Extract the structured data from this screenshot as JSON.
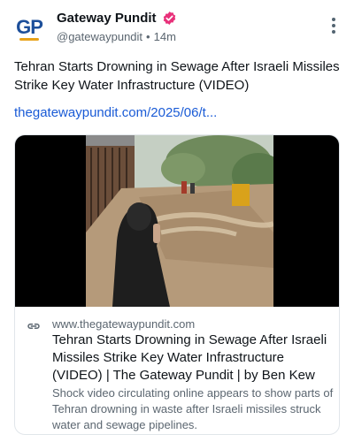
{
  "account": {
    "avatar_text": "GP",
    "display_name": "Gateway Pundit",
    "handle": "@gatewaypundit",
    "separator": "•",
    "time_ago": "14m",
    "verified": true
  },
  "post": {
    "text": "Tehran Starts Drowning in Sewage After Israeli Missiles Strike Key Water Infrastructure (VIDEO)",
    "link": "thegatewaypundit.com/2025/06/t..."
  },
  "card": {
    "domain": "www.thegatewaypundit.com",
    "title": "Tehran Starts Drowning in Sewage After Israeli Missiles Strike Key Water Infrastructure (VIDEO) | The Gateway Pundit | by Ben Kew",
    "description": "Shock video circulating online appears to show parts of Tehran drowning in waste after Israeli missiles struck water and sewage pipelines."
  },
  "colors": {
    "verified_badge": "#e8317a",
    "link": "#1a5bd6",
    "avatar_brand": "#1d4f9a",
    "avatar_accent": "#e8a21a"
  },
  "icons": {
    "more": "vertical-ellipsis-icon",
    "card_link": "link-chain-icon",
    "verified": "verified-badge-icon"
  }
}
